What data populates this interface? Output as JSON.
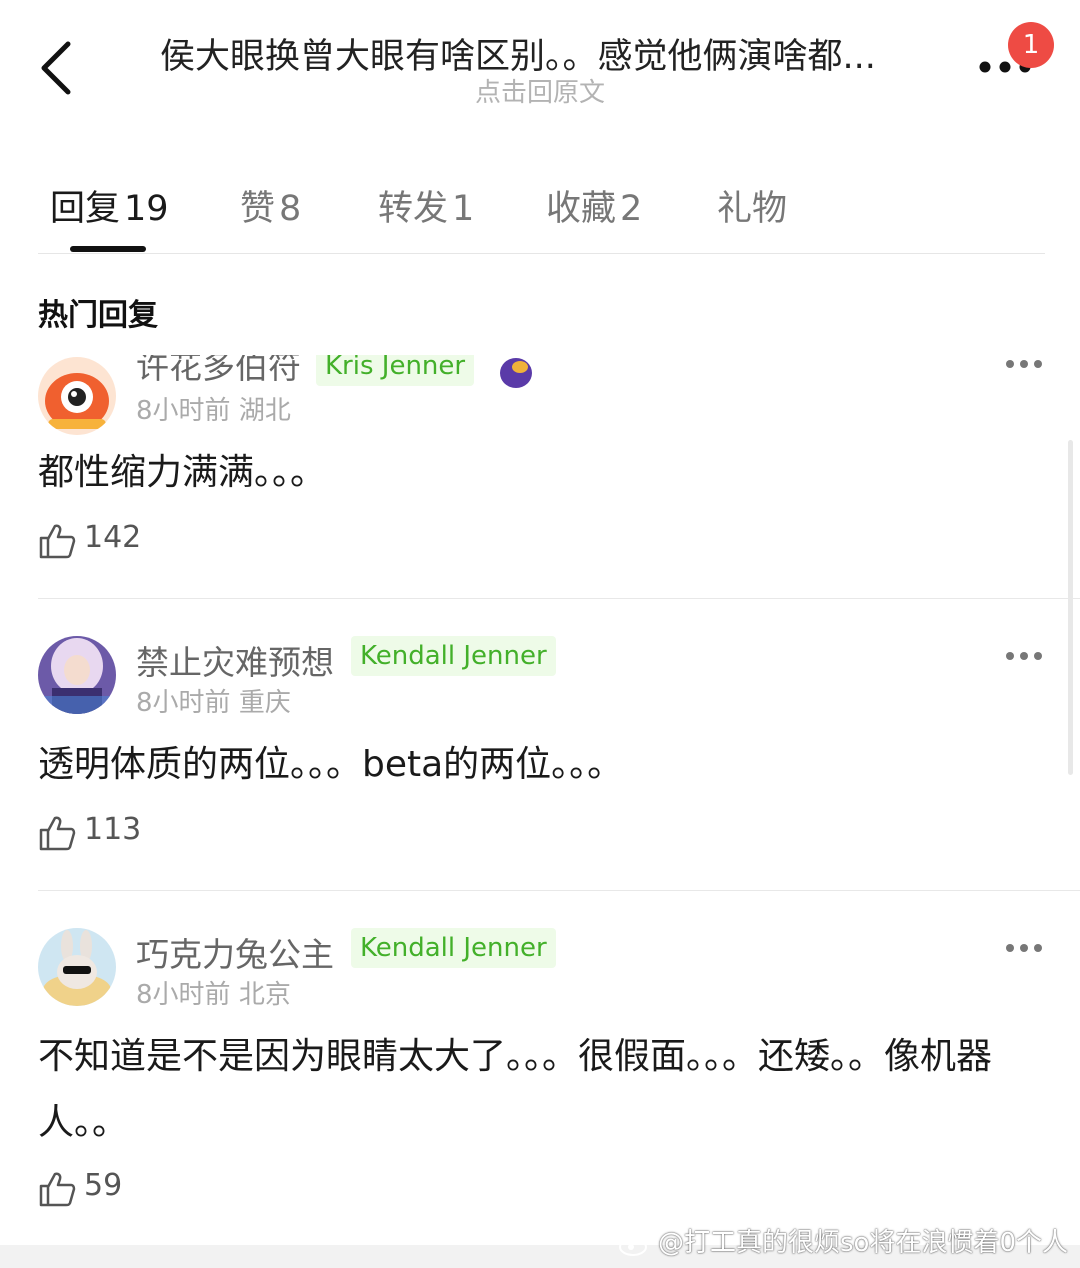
{
  "header": {
    "title": "侯大眼换曾大眼有啥区别。。感觉他俩演啥都...",
    "subtitle": "点击回原文",
    "notification_count": "1"
  },
  "tabs": [
    {
      "label": "回复",
      "count": "19",
      "active": true
    },
    {
      "label": "赞",
      "count": "8",
      "active": false
    },
    {
      "label": "转发",
      "count": "1",
      "active": false
    },
    {
      "label": "收藏",
      "count": "2",
      "active": false
    },
    {
      "label": "礼物",
      "count": "",
      "active": false
    }
  ],
  "section_title": "热门回复",
  "comments": [
    {
      "username": "许花多伯符",
      "badge": "Kris Jenner",
      "time": "8小时前",
      "location": "湖北",
      "text": "都性缩力满满。。。",
      "likes": "142"
    },
    {
      "username": "禁止灾难预想",
      "badge": "Kendall Jenner",
      "time": "8小时前",
      "location": "重庆",
      "text": "透明体质的两位。。。beta的两位。。。",
      "likes": "113"
    },
    {
      "username": "巧克力兔公主",
      "badge": "Kendall Jenner",
      "time": "8小时前",
      "location": "北京",
      "text": "不知道是不是因为眼睛太大了。。。很假面。。。还矮。。像机器人。。",
      "likes": "59"
    }
  ],
  "watermark": "@打工真的很烦so将在浪惯着0个人",
  "colors": {
    "badge_red": "#ee4b44",
    "fan_badge_text": "#43b02a",
    "fan_badge_bg": "#eefbe8"
  }
}
